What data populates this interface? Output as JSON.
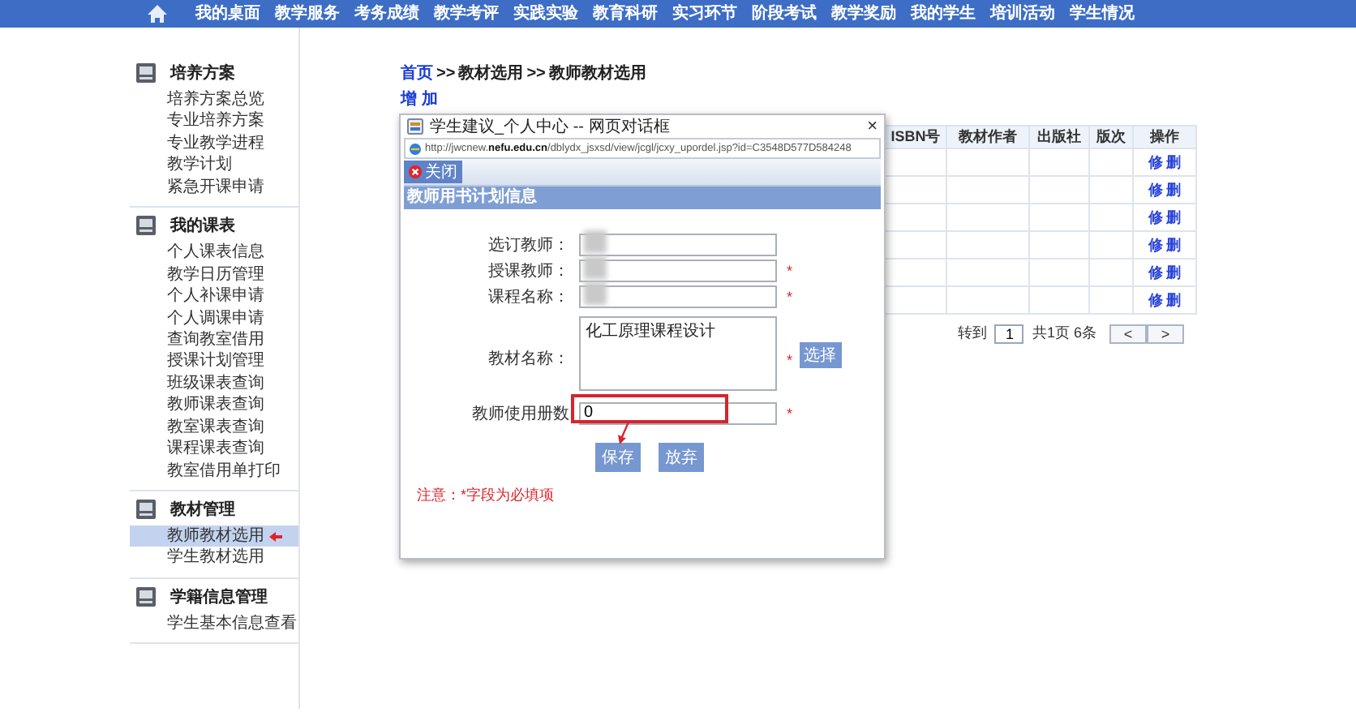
{
  "nav": {
    "items": [
      {
        "label": "我的桌面"
      },
      {
        "label": "教学服务"
      },
      {
        "label": "考务成绩"
      },
      {
        "label": "教学考评"
      },
      {
        "label": "实践实验"
      },
      {
        "label": "教育科研"
      },
      {
        "label": "实习环节"
      },
      {
        "label": "阶段考试"
      },
      {
        "label": "教学奖励"
      },
      {
        "label": "我的学生"
      },
      {
        "label": "培训活动"
      },
      {
        "label": "学生情况"
      }
    ]
  },
  "sidebar": {
    "sections": [
      {
        "title": "培养方案",
        "items": [
          {
            "label": "培养方案总览",
            "selected": false
          },
          {
            "label": "专业培养方案",
            "selected": false
          },
          {
            "label": "专业教学进程",
            "selected": false
          },
          {
            "label": "教学计划",
            "selected": false
          },
          {
            "label": "紧急开课申请",
            "selected": false
          }
        ]
      },
      {
        "title": "我的课表",
        "items": [
          {
            "label": "个人课表信息",
            "selected": false
          },
          {
            "label": "教学日历管理",
            "selected": false
          },
          {
            "label": "个人补课申请",
            "selected": false
          },
          {
            "label": "个人调课申请",
            "selected": false
          },
          {
            "label": "查询教室借用",
            "selected": false
          },
          {
            "label": "授课计划管理",
            "selected": false
          },
          {
            "label": "班级课表查询",
            "selected": false
          },
          {
            "label": "教师课表查询",
            "selected": false
          },
          {
            "label": "教室课表查询",
            "selected": false
          },
          {
            "label": "课程课表查询",
            "selected": false
          },
          {
            "label": "教室借用单打印",
            "selected": false
          }
        ]
      },
      {
        "title": "教材管理",
        "items": [
          {
            "label": "教师教材选用",
            "selected": true
          },
          {
            "label": "学生教材选用",
            "selected": false
          }
        ]
      },
      {
        "title": "学籍信息管理",
        "items": [
          {
            "label": "学生基本信息查看",
            "selected": false
          }
        ]
      }
    ]
  },
  "breadcrumb": [
    {
      "kind": "link",
      "text": "首页"
    },
    {
      "kind": "separator",
      "text": ">>"
    },
    {
      "kind": "text",
      "text": "教材选用"
    },
    {
      "kind": "separator",
      "text": ">>"
    },
    {
      "kind": "text",
      "text": "教师教材选用"
    }
  ],
  "add_link": "增 加",
  "table": {
    "columns": [
      "ISBN号",
      "教材作者",
      "出版社",
      "版次",
      "操作"
    ],
    "rows": [
      {
        "actions": [
          "修",
          "删"
        ]
      },
      {
        "actions": [
          "修",
          "删"
        ]
      },
      {
        "actions": [
          "修",
          "删"
        ]
      },
      {
        "actions": [
          "修",
          "删"
        ]
      },
      {
        "actions": [
          "修",
          "删"
        ]
      },
      {
        "actions": [
          "修",
          "删"
        ]
      }
    ]
  },
  "pager": {
    "goto_label": "转到",
    "page": "1",
    "summary": "共1页 6条",
    "prev": "<",
    "next": ">"
  },
  "dialog": {
    "title": "学生建议_个人中心 -- 网页对话框",
    "close": "×",
    "url": "http://jwcnew.**nefu.edu.cn**/dblydx_jsxsd/view/jcgl/jcxy_upordel.jsp?id=C3548D577D584248",
    "close_button": "关闭",
    "section_title": "教师用书计划信息",
    "fields": [
      {
        "kind": "text",
        "label": "选订教师：",
        "redacted": true,
        "highlighted": false
      },
      {
        "kind": "text",
        "label": "授课教师：",
        "redacted": true,
        "asterisk": "*",
        "highlighted": false
      },
      {
        "kind": "text",
        "label": "课程名称：",
        "redacted": true,
        "asterisk": "*",
        "highlighted": false
      },
      {
        "kind": "textarea",
        "label": "教材名称：",
        "value": "化工原理课程设计",
        "redacted": false,
        "asterisk": "*",
        "button": "选择",
        "highlighted": false
      },
      {
        "kind": "text",
        "label": "教师使用册数",
        "value": "0",
        "redacted": false,
        "asterisk": "*",
        "highlighted": true
      }
    ],
    "save": "保存",
    "discard": "放弃",
    "note": "注意：*字段为必填项"
  }
}
